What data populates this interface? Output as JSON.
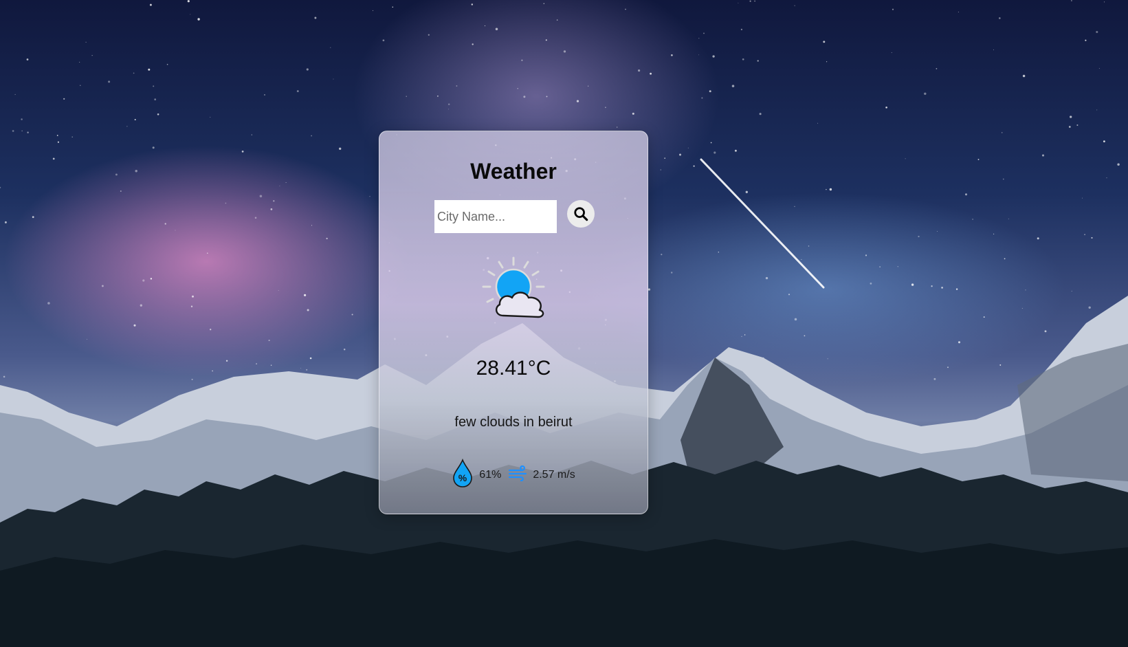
{
  "app": {
    "title": "Weather"
  },
  "search": {
    "placeholder": "City Name...",
    "value": "",
    "button_icon": "search-icon"
  },
  "weather": {
    "icon": "partly-cloudy-icon",
    "temperature": "28.41°C",
    "description": "few clouds in beirut",
    "humidity": "61%",
    "humidity_icon": "humidity-drop-icon",
    "wind": "2.57 m/s",
    "wind_icon": "wind-icon"
  },
  "colors": {
    "sun": "#12a4f5",
    "drop": "#12a4f5",
    "wind": "#1e90ff",
    "title": "#0a0a0a"
  }
}
